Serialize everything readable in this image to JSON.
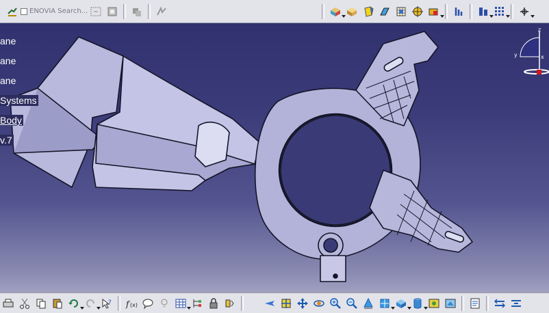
{
  "top_toolbar": {
    "enovia_label": "ENOVIA Search...",
    "icons": [
      "select-arrow-icon",
      "undo-cmd-icon",
      "select-tool-icon",
      "axis-icon",
      "snap-icon",
      "pan-icon",
      "rotate-view-icon",
      "color-cube-icon",
      "cube-face-icon",
      "material-icon",
      "cube-wire-icon",
      "grid-snap-icon",
      "target-icon",
      "apply-material-icon",
      "measure-icon",
      "view-mode-icon",
      "pattern-grid-icon",
      "axis-system-icon"
    ]
  },
  "spec_tree": {
    "items": [
      {
        "label": "ane"
      },
      {
        "label": "ane"
      },
      {
        "label": "ane"
      },
      {
        "label": "Systems"
      },
      {
        "label": "Body"
      },
      {
        "label": "v.7"
      }
    ]
  },
  "compass": {
    "z_label": "z",
    "y_label": "y",
    "x_label": "x"
  },
  "bottom_toolbar": {
    "icons": [
      "print-icon",
      "cut-icon",
      "copy-icon",
      "paste-icon",
      "undo-icon",
      "redo-icon",
      "whats-this-icon",
      "formula-icon",
      "comment-icon",
      "knowledge-icon",
      "table-icon",
      "spec-tree-icon",
      "lock-icon",
      "catalog-icon",
      "fly-mode-icon",
      "fit-all-icon",
      "pan-icon",
      "rotate-icon",
      "zoom-in-icon",
      "zoom-out-icon",
      "normal-view-icon",
      "iso-view-icon",
      "view-cube-icon",
      "shading-icon",
      "hide-show-icon",
      "swap-visible-icon",
      "spacebar-icon",
      "product-icon",
      "collapse-icon"
    ]
  },
  "colors": {
    "background_top": "#2e2f6c",
    "background_bottom": "#b9bad0",
    "part_fill": "#b7b7dc",
    "part_edge": "#141428",
    "toolbar": "#e3e3ea"
  }
}
